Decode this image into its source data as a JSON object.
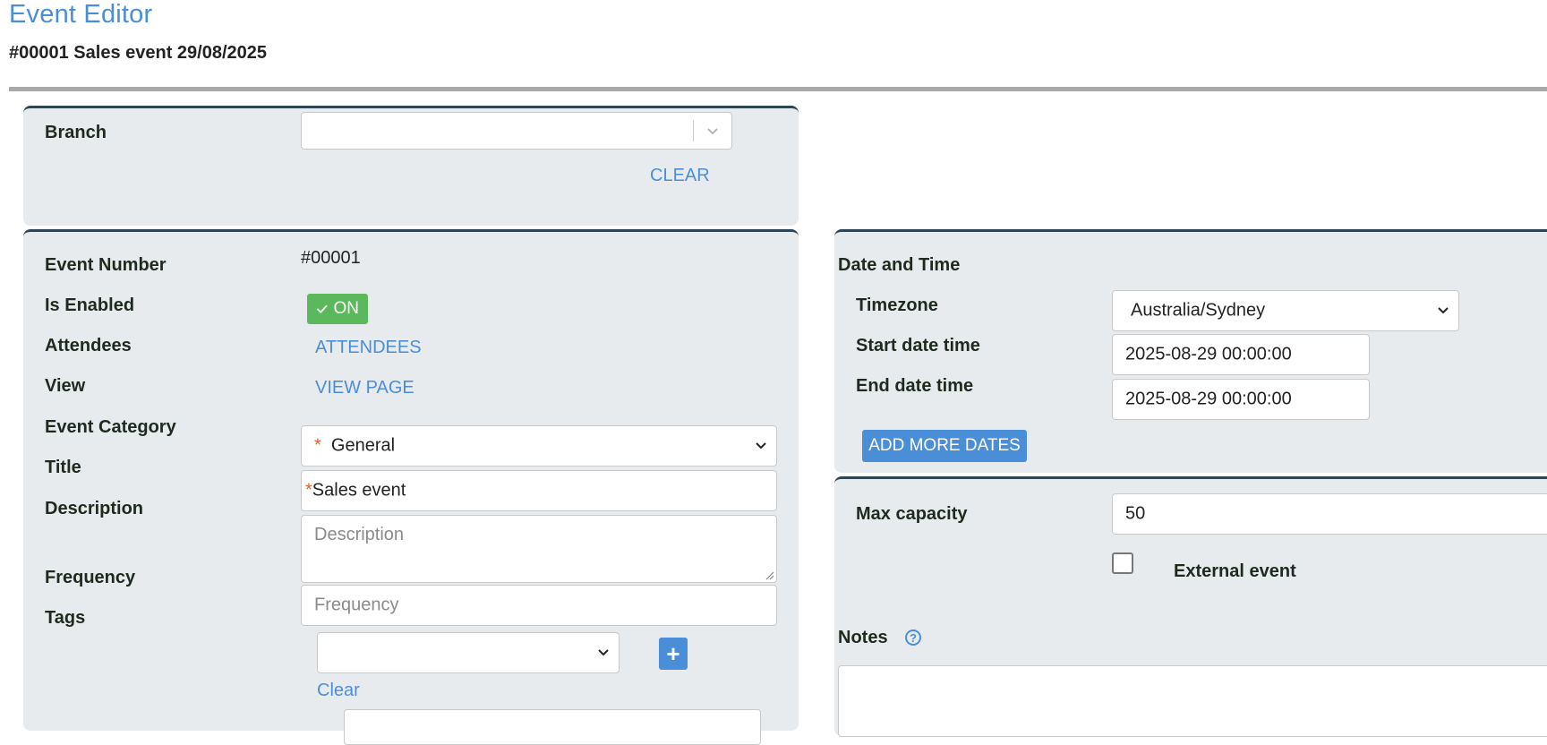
{
  "header": {
    "title": "Event Editor",
    "subtitle": "#00001 Sales event 29/08/2025"
  },
  "branch": {
    "label": "Branch",
    "value": "",
    "clear_label": "CLEAR"
  },
  "main": {
    "event_number_label": "Event Number",
    "event_number_value": "#00001",
    "is_enabled_label": "Is Enabled",
    "toggle_label": "ON",
    "attendees_label": "Attendees",
    "attendees_link": "ATTENDEES",
    "view_label": "View",
    "view_link": "VIEW PAGE",
    "category_label": "Event Category",
    "category_value": "General",
    "title_label": "Title",
    "title_value": "Sales event",
    "description_label": "Description",
    "description_placeholder": "Description",
    "frequency_label": "Frequency",
    "frequency_placeholder": "Frequency",
    "tags_label": "Tags",
    "tags_value": "",
    "tags_add": "+",
    "tags_clear": "Clear",
    "required_mark": "*"
  },
  "datetime": {
    "section_label": "Date and Time",
    "timezone_label": "Timezone",
    "timezone_value": "Australia/Sydney",
    "start_label": "Start date time",
    "start_value": "2025-08-29 00:00:00",
    "end_label": "End date time",
    "end_value": "2025-08-29 00:00:00",
    "add_more_label": "ADD MORE DATES"
  },
  "capacity": {
    "max_label": "Max capacity",
    "max_value": "50",
    "external_label": "External event",
    "external_checked": false,
    "notes_label": "Notes",
    "help_glyph": "?"
  },
  "colors": {
    "accent": "#4a8ed8",
    "toggle_on": "#5cb85c",
    "panel_bg": "#e8ebee",
    "panel_border": "#2f4554",
    "required": "#e0622b"
  }
}
